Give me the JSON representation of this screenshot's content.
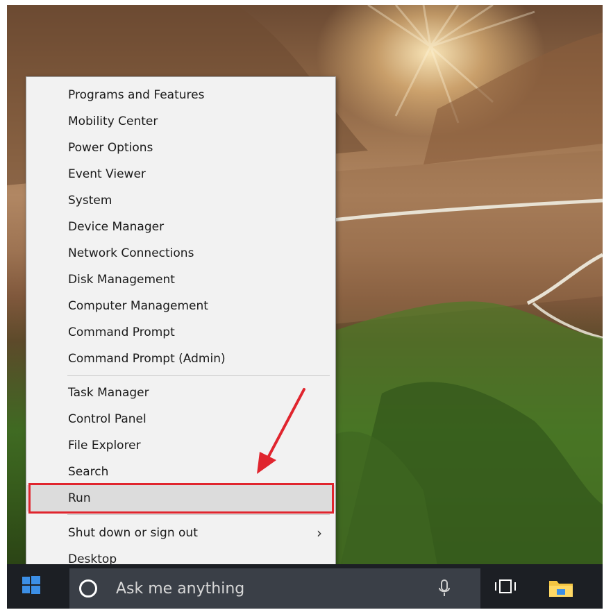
{
  "menu": {
    "group1": [
      "Programs and Features",
      "Mobility Center",
      "Power Options",
      "Event Viewer",
      "System",
      "Device Manager",
      "Network Connections",
      "Disk Management",
      "Computer Management",
      "Command Prompt",
      "Command Prompt (Admin)"
    ],
    "group2": [
      "Task Manager",
      "Control Panel",
      "File Explorer",
      "Search",
      "Run"
    ],
    "group3": [
      "Shut down or sign out",
      "Desktop"
    ],
    "selected": "Run",
    "submenu_chevron": "›"
  },
  "taskbar": {
    "search_placeholder": "Ask me anything"
  },
  "annotation": {
    "highlight_color": "#e0252e",
    "arrow_color": "#e0252e"
  },
  "icons": [
    "windows-logo-icon",
    "cortana-icon",
    "microphone-icon",
    "task-view-icon",
    "file-explorer-icon",
    "chevron-right-icon",
    "red-arrow-icon"
  ]
}
